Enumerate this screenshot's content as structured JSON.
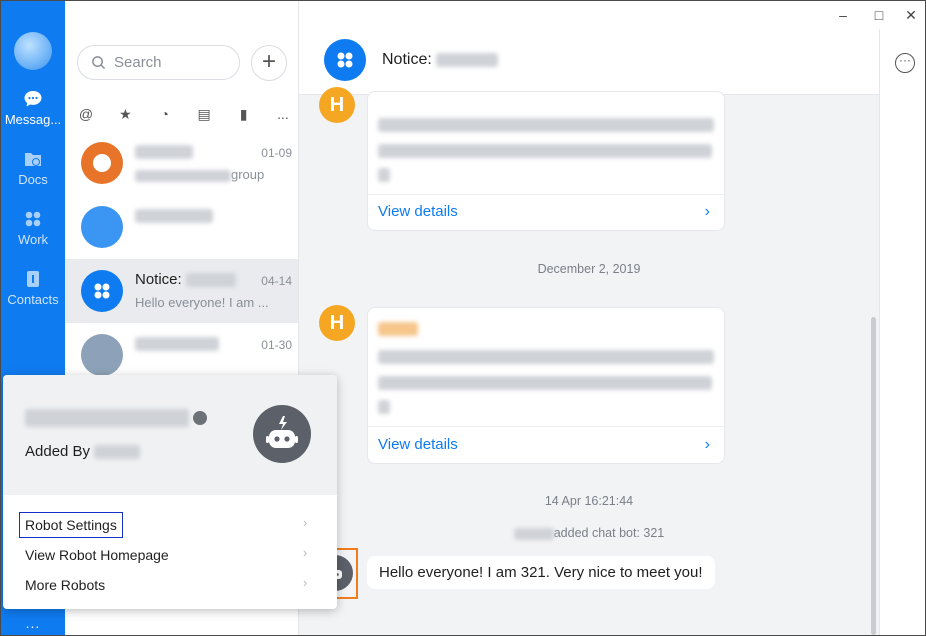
{
  "rail": {
    "items": [
      {
        "label": "Messag...",
        "icon": "chat-bubble-icon",
        "active": true
      },
      {
        "label": "Docs",
        "icon": "docs-folder-icon",
        "active": false
      },
      {
        "label": "Work",
        "icon": "grid-icon",
        "active": false
      },
      {
        "label": "Contacts",
        "icon": "contacts-icon",
        "active": false
      }
    ],
    "more": "..."
  },
  "list": {
    "search_placeholder": "Search",
    "plus": "+",
    "filters": [
      "at-icon",
      "star-icon",
      "clock-icon",
      "archive-icon",
      "file-icon",
      "more-icon"
    ],
    "filters_more_label": "...",
    "conversations": [
      {
        "date": "01-09",
        "preview_suffix": "group"
      },
      {
        "date": ""
      },
      {
        "name": "Notice:",
        "date": "04-14",
        "preview": "Hello everyone! I am ..."
      },
      {
        "date": "01-30"
      }
    ]
  },
  "header": {
    "title": "Notice:"
  },
  "chat": {
    "cards": [
      {
        "details": "View details"
      },
      {
        "details": "View details"
      }
    ],
    "timestamps": [
      "December 2, 2019",
      "14 Apr 16:21:44"
    ],
    "system_note": "added chat bot: 321",
    "bubble": "Hello everyone! I am 321. Very nice to meet you!"
  },
  "popup": {
    "added_by": "Added By",
    "menu": [
      "Robot Settings",
      "View Robot Homepage",
      "More Robots"
    ]
  },
  "colors": {
    "primary": "#0f7bf0",
    "accent_orange": "#f5a623",
    "highlight_blue": "#1530c8",
    "highlight_orange": "#f07d1a"
  }
}
